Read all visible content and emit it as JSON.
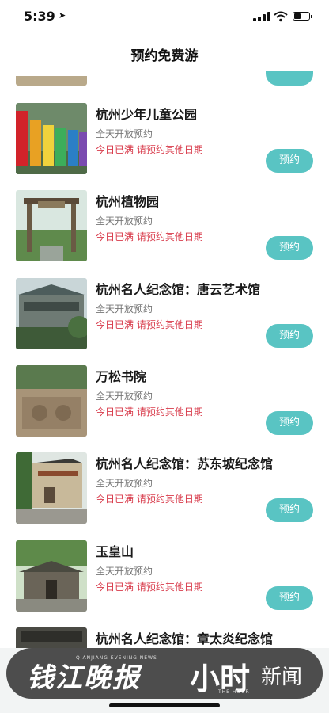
{
  "status_bar": {
    "time": "5:39"
  },
  "nav": {
    "title": "预约免费游"
  },
  "items": [
    {
      "name": "杭州少年儿童公园",
      "sub": "全天开放预约",
      "status": "今日已满 请预约其他日期",
      "button": "预约"
    },
    {
      "name": "杭州植物园",
      "sub": "全天开放预约",
      "status": "今日已满 请预约其他日期",
      "button": "预约"
    },
    {
      "name": "杭州名人纪念馆：唐云艺术馆",
      "sub": "全天开放预约",
      "status": "今日已满 请预约其他日期",
      "button": "预约"
    },
    {
      "name": "万松书院",
      "sub": "全天开放预约",
      "status": "今日已满 请预约其他日期",
      "button": "预约"
    },
    {
      "name": "杭州名人纪念馆：苏东坡纪念馆",
      "sub": "全天开放预约",
      "status": "今日已满 请预约其他日期",
      "button": "预约"
    },
    {
      "name": "玉皇山",
      "sub": "全天开放预约",
      "status": "今日已满 请预约其他日期",
      "button": "预约"
    },
    {
      "name": "杭州名人纪念馆：章太炎纪念馆"
    }
  ],
  "watermark": {
    "left_logo": "钱江晚报",
    "left_en": "QIANJIANG EVENING NEWS",
    "mid_logo": "小时",
    "mid_en": "THE HOUR",
    "right_text": "新闻"
  },
  "colors": {
    "accent": "#59c4c3",
    "alert": "#d83a4a"
  }
}
